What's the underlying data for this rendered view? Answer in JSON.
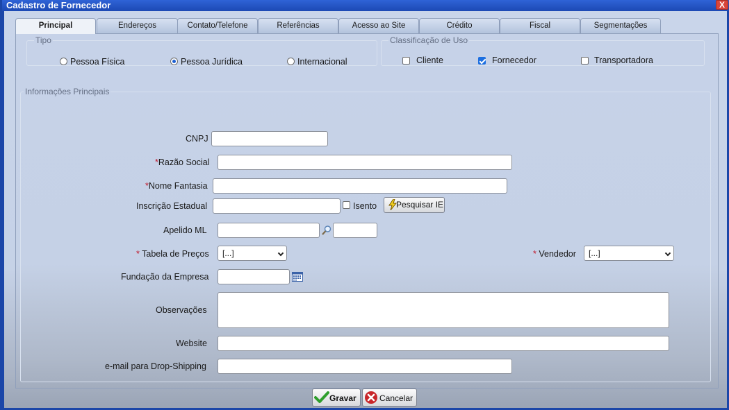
{
  "window": {
    "title": "Cadastro de Fornecedor",
    "close_label": "X"
  },
  "tabs": [
    {
      "label": "Principal",
      "active": true
    },
    {
      "label": "Endereços"
    },
    {
      "label": "Contato/Telefone"
    },
    {
      "label": "Referências"
    },
    {
      "label": "Acesso ao Site"
    },
    {
      "label": "Crédito"
    },
    {
      "label": "Fiscal"
    },
    {
      "label": "Segmentações"
    }
  ],
  "tipo": {
    "legend": "Tipo",
    "options": [
      {
        "label": "Pessoa Física",
        "selected": false
      },
      {
        "label": "Pessoa Jurídica",
        "selected": true
      },
      {
        "label": "Internacional",
        "selected": false
      }
    ]
  },
  "classificacao": {
    "legend": "Classificação de Uso",
    "options": [
      {
        "label": "Cliente",
        "checked": false
      },
      {
        "label": "Fornecedor",
        "checked": true
      },
      {
        "label": "Transportadora",
        "checked": false
      }
    ]
  },
  "info": {
    "legend": "Informações Principais",
    "required_mark": "*",
    "cnpj_label": "CNPJ",
    "razao_label": "Razão Social",
    "fantasia_label": "Nome Fantasia",
    "ie_label": "Inscrição Estadual",
    "isento_label": "Isento",
    "pesquisar_ie_label": "Pesquisar IE",
    "apelido_label": "Apelido ML",
    "tabela_label": "Tabela de Preços",
    "tabela_value": "[...]",
    "vendedor_label": "Vendedor",
    "vendedor_value": "[...]",
    "fundacao_label": "Fundação da Empresa",
    "observacoes_label": "Observações",
    "website_label": "Website",
    "email_label": "e-mail para Drop-Shipping"
  },
  "footer": {
    "gravar_label": "Gravar",
    "cancelar_label": "Cancelar"
  },
  "colors": {
    "titlebar": "#1c49b4",
    "accent_check": "#1d6fe0",
    "required": "#c0192b"
  }
}
